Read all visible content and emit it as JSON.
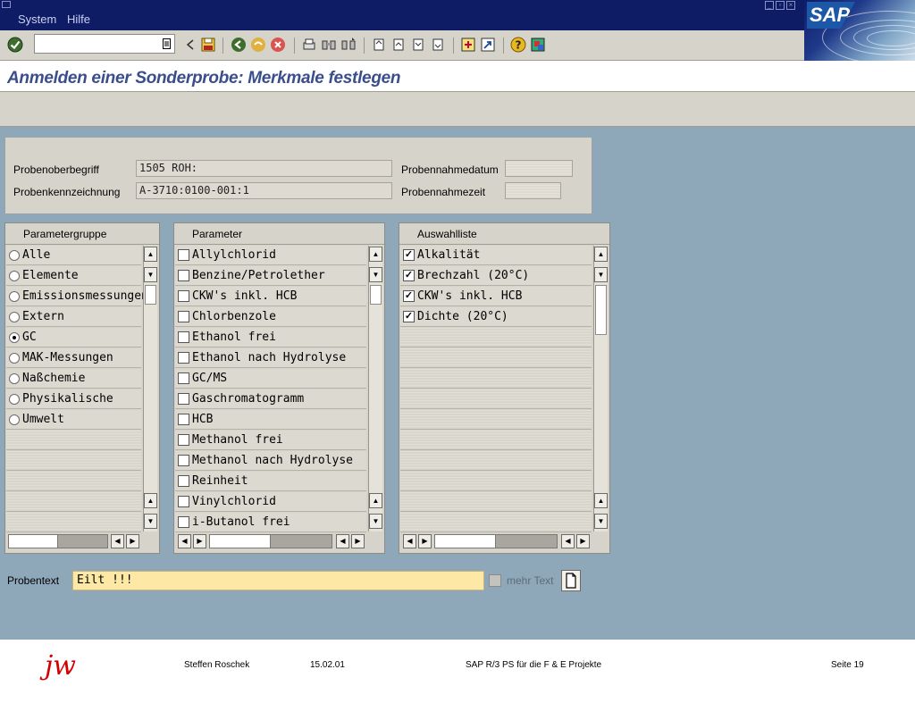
{
  "menubar": {
    "items": [
      "System",
      "Hilfe"
    ]
  },
  "sap_logo": "SAP",
  "title": "Anmelden einer Sonderprobe: Merkmale festlegen",
  "header": {
    "probenoberbegriff_label": "Probenoberbegriff",
    "probenoberbegriff_value": "1505 ROH:",
    "probenkennzeichnung_label": "Probenkennzeichnung",
    "probenkennzeichnung_value": "A-3710:0100-001:1",
    "probennahmedatum_label": "Probennahmedatum",
    "probennahmezeit_label": "Probennahmezeit"
  },
  "parametergruppe": {
    "title": "Parametergruppe",
    "items": [
      "Alle",
      "Elemente",
      "Emissionsmessungen",
      "Extern",
      "GC",
      "MAK-Messungen",
      "Naßchemie",
      "Physikalische",
      "Umwelt"
    ],
    "selected": "GC"
  },
  "parameter": {
    "title": "Parameter",
    "items": [
      "Allylchlorid",
      "Benzine/Petrolether",
      "CKW's inkl. HCB",
      "Chlorbenzole",
      "Ethanol frei",
      "Ethanol nach Hydrolyse",
      "GC/MS",
      "Gaschromatogramm",
      "HCB",
      "Methanol frei",
      "Methanol nach Hydrolyse",
      "Reinheit",
      "Vinylchlorid",
      "i-Butanol frei"
    ]
  },
  "auswahlliste": {
    "title": "Auswahlliste",
    "items": [
      "Alkalität",
      "Brechzahl (20°C)",
      "CKW's inkl. HCB",
      "Dichte (20°C)"
    ],
    "checked": [
      true,
      true,
      true,
      true
    ]
  },
  "probentext": {
    "label": "Probentext",
    "value": "Eilt !!!",
    "mehr_text_label": "mehr Text"
  },
  "footer": {
    "logo": "jw",
    "author": "Steffen Roschek",
    "date": "15.02.01",
    "title": "SAP R/3 PS für die F & E Projekte",
    "page": "Seite 19"
  },
  "colors": {
    "menubar": "#0e1c66",
    "work_area": "#8ea7b9",
    "panel": "#d6d3cb",
    "title_text": "#3b4e8c",
    "probentext_bg": "#fde8a6"
  }
}
